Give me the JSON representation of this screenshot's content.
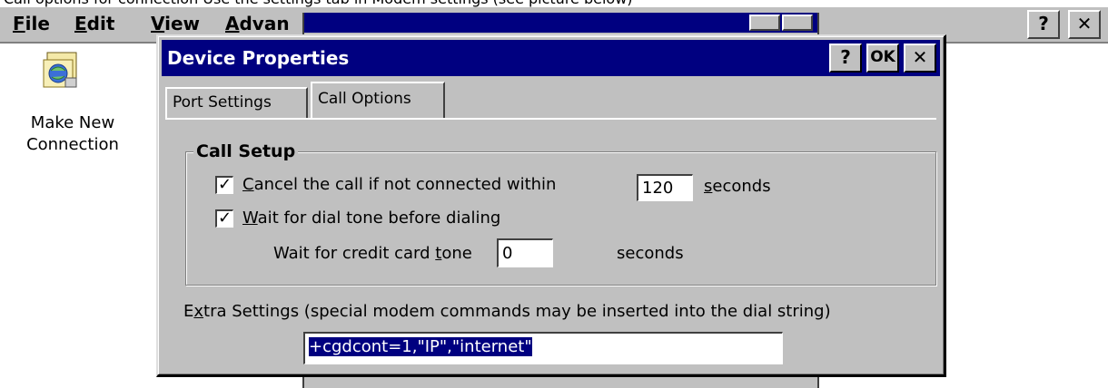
{
  "caption": "Call options for connection Use the settings tab in Modem settings (see picture below)",
  "menubar": {
    "items": [
      {
        "pre": "",
        "mnemonic": "F",
        "post": "ile"
      },
      {
        "pre": "",
        "mnemonic": "E",
        "post": "dit"
      },
      {
        "pre": "",
        "mnemonic": "V",
        "post": "iew"
      },
      {
        "pre": "",
        "mnemonic": "A",
        "post": "dvan"
      }
    ],
    "help_label": "?",
    "close_label": "✕"
  },
  "desktop_icon": {
    "line1": "Make New",
    "line2": "Connection"
  },
  "dialog": {
    "title": "Device Properties",
    "help_label": "?",
    "ok_label": "OK",
    "close_label": "✕",
    "tabs": [
      {
        "label": "Port Settings",
        "active": false
      },
      {
        "label": "Call Options",
        "active": true
      }
    ],
    "call_setup": {
      "title": "Call Setup",
      "cancel_call": {
        "checked": true,
        "mnemonic": "C",
        "rest": "ancel the call if not connected within",
        "value": "120",
        "unit_mnemonic": "s",
        "unit_rest": "econds"
      },
      "wait_dial_tone": {
        "checked": true,
        "mnemonic": "W",
        "rest": "ait for dial tone before dialing"
      },
      "credit_card_tone": {
        "pre": "Wait for credit card ",
        "mnemonic": "t",
        "post": "one",
        "value": "0",
        "unit": "seconds"
      }
    },
    "extra_settings": {
      "pre": "E",
      "mnemonic": "x",
      "post": "tra Settings (special modem commands may be inserted into the dial string)",
      "value": "+cgdcont=1,\"IP\",\"internet\""
    }
  }
}
